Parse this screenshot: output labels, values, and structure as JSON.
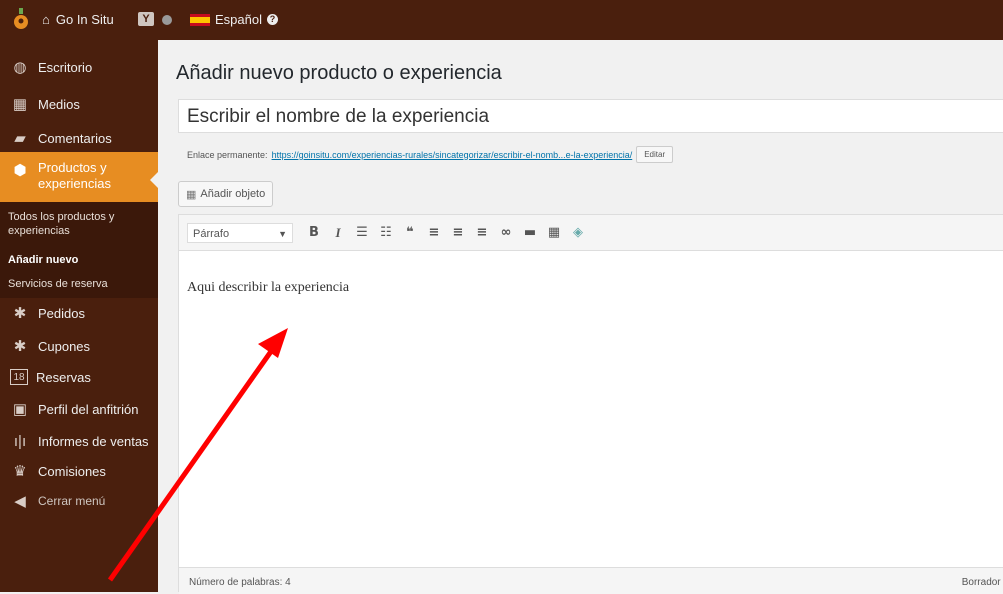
{
  "adminbar": {
    "site_name": "Go In Situ",
    "yoast_label": "Y",
    "language": "Español"
  },
  "sidebar": {
    "items": [
      {
        "label": "Escritorio",
        "icon": "dashboard-icon"
      },
      {
        "label": "Medios",
        "icon": "media-icon"
      },
      {
        "label": "Comentarios",
        "icon": "comments-icon"
      },
      {
        "label": "Productos y experiencias",
        "icon": "products-icon"
      },
      {
        "label": "Pedidos",
        "icon": "orders-icon"
      },
      {
        "label": "Cupones",
        "icon": "coupons-icon"
      },
      {
        "label": "Reservas",
        "icon": "calendar-icon"
      },
      {
        "label": "Perfil del anfitrión",
        "icon": "profile-icon"
      },
      {
        "label": "Informes de ventas",
        "icon": "chart-icon"
      },
      {
        "label": "Comisiones",
        "icon": "commissions-icon"
      },
      {
        "label": "Cerrar menú",
        "icon": "collapse-icon"
      }
    ],
    "submenu": [
      "Todos los productos y experiencias",
      "Añadir nuevo",
      "Servicios de reserva"
    ]
  },
  "main": {
    "page_title": "Añadir nuevo producto o experiencia",
    "title_value": "Escribir el nombre de la experiencia",
    "permalink_label": "Enlace permanente:",
    "permalink_url": "https://goinsitu.com/experiencias-rurales/sincategorizar/escribir-el-nomb...e-la-experiencia/",
    "edit_label": "Editar",
    "add_media_label": "Añadir objeto",
    "format_value": "Párrafo",
    "body_text": "Aqui describir la experiencia",
    "word_count": "Número de palabras: 4",
    "draft_status": "Borrador guard"
  },
  "colors": {
    "sidebar_bg": "#4a1f0d",
    "active_bg": "#e78d22",
    "arrow": "#ff0000"
  }
}
